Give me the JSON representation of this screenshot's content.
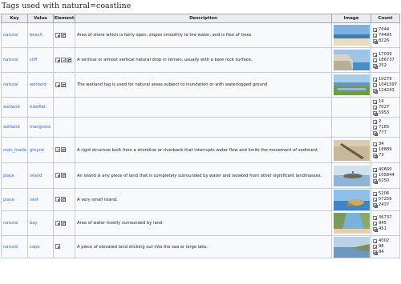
{
  "page_title": "Tags used with natural=coastline",
  "headers": {
    "key": "Key",
    "value": "Value",
    "element": "Element",
    "description": "Description",
    "image": "Image",
    "count": "Count"
  },
  "rows": [
    {
      "key": "natural",
      "value": "beach",
      "elements": [
        "node",
        "area"
      ],
      "description": "Area of shore which is fairly open, slopes smoothly to the water, and is free of trees",
      "image": "beach",
      "counts": [
        "7044",
        "74495",
        "8226"
      ]
    },
    {
      "key": "natural",
      "value": "cliff",
      "elements": [
        "node",
        "way",
        "area"
      ],
      "description": "A vertical or almost vertical natural drop in terrain, usually with a bare rock surface.",
      "image": "cliff",
      "counts": [
        "17039",
        "186737",
        "252"
      ]
    },
    {
      "key": "natural",
      "value": "wetland",
      "elements": [
        "node",
        "area"
      ],
      "description": "The wetland tag is used for natural areas subject to inundation or with waterlogged ground",
      "image": "wetland",
      "counts": [
        "10279",
        "1041597",
        "124243"
      ]
    },
    {
      "key": "wetland",
      "value": "tidalflat",
      "elements": [],
      "description": "",
      "image": "",
      "counts": [
        "14",
        "7027",
        "5953"
      ]
    },
    {
      "key": "wetland",
      "value": "mangrove",
      "elements": [],
      "description": "",
      "image": "",
      "counts": [
        "2",
        "7165",
        "777"
      ]
    },
    {
      "key": "man_made",
      "value": "groyne",
      "elements": [
        "way",
        "area"
      ],
      "description": "A rigid structure built from a shoreline or riverbank that interrupts water flow and limits the movement of sediment",
      "image": "groyne",
      "counts": [
        "34",
        "18889",
        "73"
      ]
    },
    {
      "key": "place",
      "value": "island",
      "elements": [
        "node",
        "area"
      ],
      "description": "An island is any piece of land that is completely surrounded by water and isolated from other significant landmasses.",
      "image": "island",
      "counts": [
        "40660",
        "105844",
        "6250"
      ]
    },
    {
      "key": "place",
      "value": "islet",
      "elements": [
        "node",
        "area"
      ],
      "description": "A very small island.",
      "image": "islet",
      "counts": [
        "5206",
        "57256",
        "2437"
      ]
    },
    {
      "key": "natural",
      "value": "bay",
      "elements": [
        "node",
        "area"
      ],
      "description": "Area of water mostly surrounded by land.",
      "image": "bay",
      "counts": [
        "36737",
        "945",
        "451"
      ]
    },
    {
      "key": "natural",
      "value": "cape",
      "elements": [
        "node"
      ],
      "description": "A piece of elevated land sticking out into the sea or large lake.",
      "image": "cape",
      "counts": [
        "4002",
        "98",
        "84"
      ]
    }
  ],
  "count_types": [
    "node",
    "way",
    "area"
  ]
}
